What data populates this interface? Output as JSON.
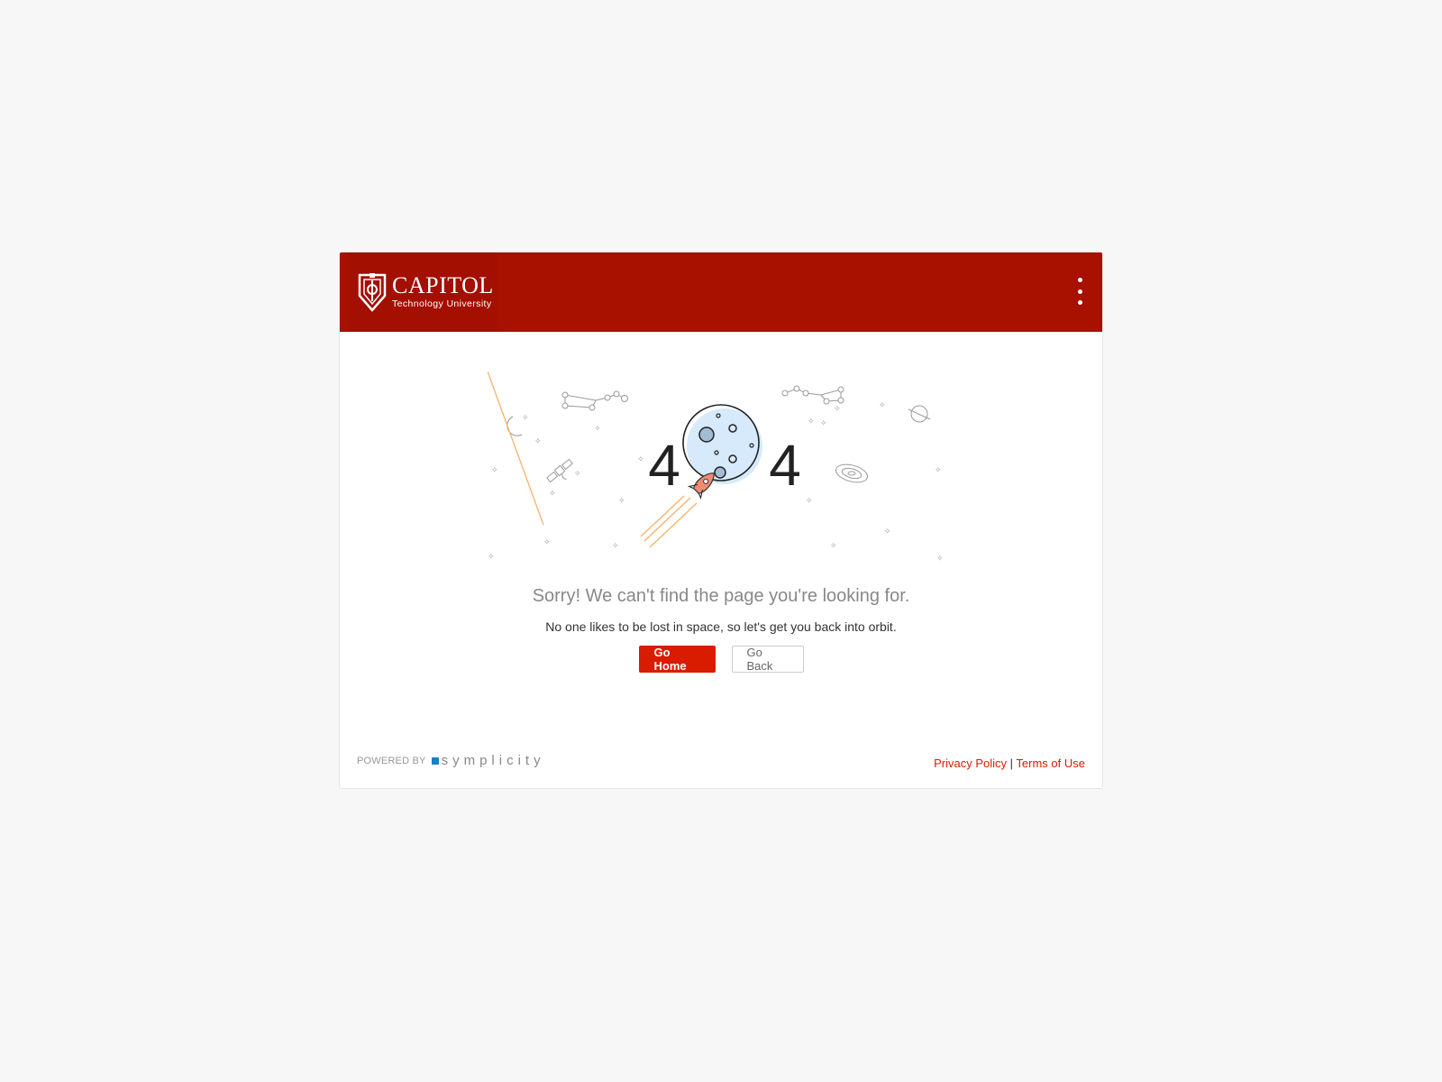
{
  "header": {
    "logo_title": "CAPITOL",
    "logo_subtitle": "Technology University",
    "menu_icon": "kebab-menu-icon",
    "brand_color": "#a81000"
  },
  "error": {
    "digit_left": "4",
    "digit_right": "4",
    "heading": "Sorry! We can't find the page you're looking for.",
    "message": "No one likes to be lost in space, so let's get you back into orbit."
  },
  "buttons": {
    "home": "Go Home",
    "back": "Go Back",
    "accent": "#d91c00"
  },
  "footer": {
    "powered_by": "POWERED BY",
    "brand": "symplicity",
    "privacy": "Privacy Policy",
    "separator": "|",
    "terms": "Terms of Use"
  }
}
